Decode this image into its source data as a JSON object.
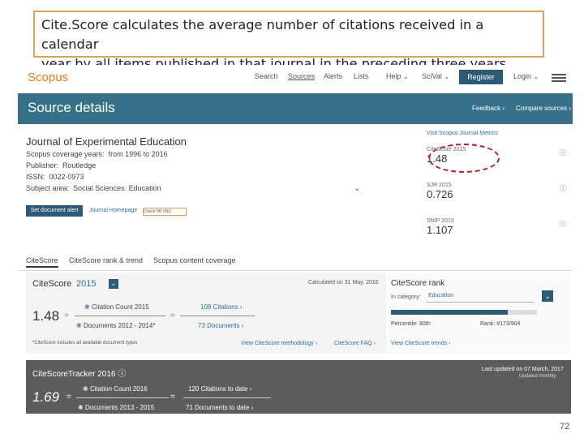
{
  "caption": {
    "line1": "Cite.Score calculates the average number of citations received in a calendar",
    "line2": "year by all items published in that journal in the preceding three years."
  },
  "topbar": {
    "logo": "Scopus",
    "nav": [
      "Search",
      "Sources",
      "Alerts",
      "Lists",
      "Help",
      "SciVal"
    ],
    "register": "Register",
    "login": "Login"
  },
  "header": {
    "title": "Source details",
    "feedback": "Feedback",
    "compare": "Compare sources"
  },
  "journal": {
    "title": "Journal of Experimental Education",
    "coverage_label": "Scopus coverage years:",
    "coverage_value": "from 1996 to 2016",
    "publisher_label": "Publisher:",
    "publisher_value": "Routledge",
    "issn_label": "ISSN:",
    "issn_value": "0022-0973",
    "subject_label": "Subject area:",
    "subject_value": "Social Sciences: Education",
    "set_alert": "Set document alert",
    "homepage": "Journal Homepage",
    "check_db": "Check DB (RE)"
  },
  "metrics": {
    "visit": "Visit Scopus Journal Metrics",
    "citescore_label": "CiteScore 2015",
    "citescore_value": "1.48",
    "sjr_label": "SJR 2015",
    "sjr_value": "0.726",
    "snip_label": "SNIP 2015",
    "snip_value": "1.107"
  },
  "tabs": [
    "CiteScore",
    "CiteScore rank & trend",
    "Scopus content coverage"
  ],
  "panel": {
    "title": "CiteScore",
    "year": "2015",
    "calculated": "Calculated on 31 May, 2016",
    "value": "1.48",
    "citation_count_label": "Citation Count 2015",
    "citation_count_value": "108 Citations",
    "documents_label": "Documents 2012 - 2014*",
    "documents_value": "73 Documents",
    "footnote": "*CiteScore includes all available document types",
    "methodology": "View CiteScore methodology",
    "faq": "CiteScore FAQ",
    "rank_title": "CiteScore rank",
    "in_category": "In category:",
    "category": "Education",
    "percentile": "Percentile: 80th",
    "rank": "Rank: #173/904",
    "trends": "View CiteScore trends"
  },
  "tracker": {
    "title": "CiteScoreTracker 2016",
    "updated": "Last updated on 07 March, 2017",
    "updated_sub": "Updated monthly",
    "value": "1.69",
    "citation_count_label": "Citation Count 2016",
    "citation_count_value": "120 Citations to date",
    "documents_label": "Documents 2013 - 2015",
    "documents_value": "71 Documents to date"
  },
  "page_number": "72"
}
